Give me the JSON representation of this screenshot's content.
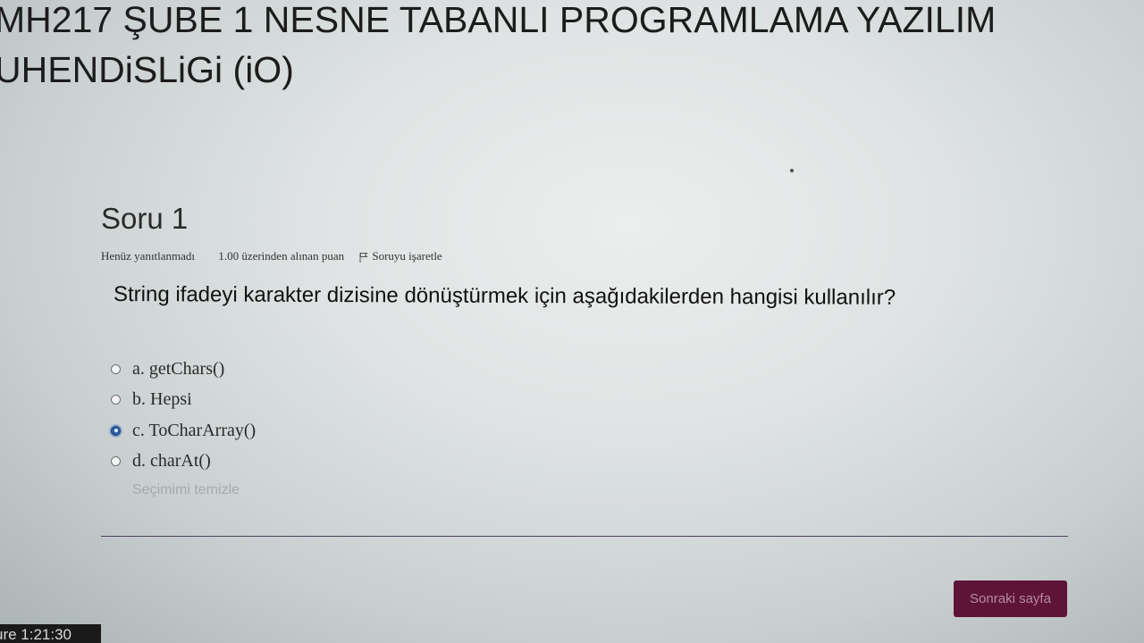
{
  "course": {
    "title_line1": "MH217 ŞUBE 1 NESNE TABANLI PROGRAMLAMA YAZILIM",
    "title_line2": "UHENDiSLiGi (iO)"
  },
  "question": {
    "number_label": "Soru 1",
    "state": "Henüz yanıtlanmadı",
    "grade": "1.00 üzerinden alınan puan",
    "flag_label": "Soruyu işaretle",
    "text": "String ifadeyi karakter dizisine dönüştürmek için aşağıdakilerden hangisi kullanılır?",
    "answers": [
      {
        "label": "a. getChars()",
        "selected": false
      },
      {
        "label": "b. Hepsi",
        "selected": false
      },
      {
        "label": "c. ToCharArray()",
        "selected": true
      },
      {
        "label": "d. charAt()",
        "selected": false
      }
    ],
    "clear_label": "Seçimimi temizle"
  },
  "navigation": {
    "next_label": "Sonraki sayfa"
  },
  "timer": {
    "text": "ure 1:21:30"
  },
  "colors": {
    "accent": "#5e1436",
    "selected_radio": "#2b5fa8"
  }
}
